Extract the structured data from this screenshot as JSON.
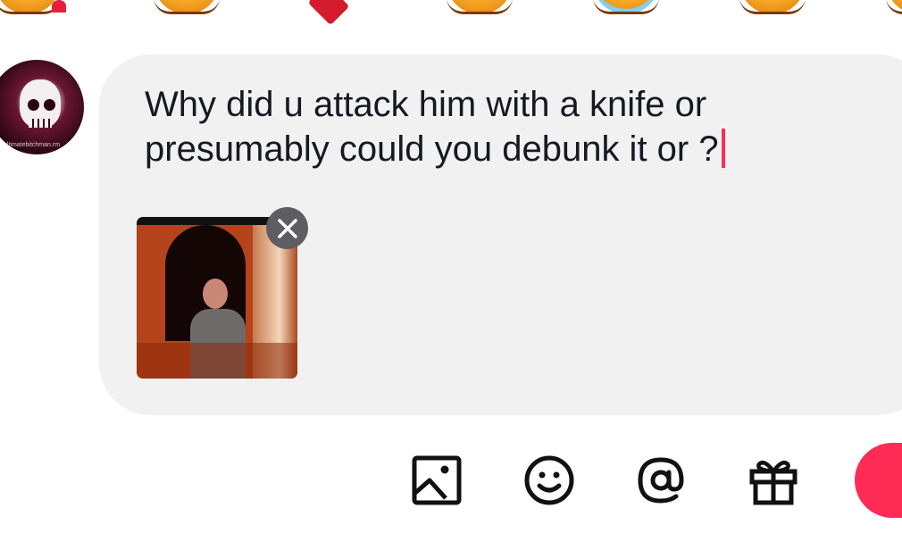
{
  "emoji_strip": {
    "items": [
      {
        "icon": "heart-eyes-face-icon"
      },
      {
        "icon": "face-icon"
      },
      {
        "icon": "heart-icon"
      },
      {
        "icon": "face-icon"
      },
      {
        "icon": "tears-of-joy-face-icon"
      },
      {
        "icon": "face-icon"
      },
      {
        "icon": "face-icon"
      }
    ]
  },
  "avatar": {
    "caption": "ultimatebitchman.rm"
  },
  "compose": {
    "text": "Why did u attack him with a knife or presumably could you debunk it or ?",
    "attachment": {
      "type": "video-thumbnail",
      "remove_icon": "close-icon"
    }
  },
  "toolbar": {
    "buttons": [
      {
        "icon": "image-icon"
      },
      {
        "icon": "emoji-icon"
      },
      {
        "icon": "at-mention-icon"
      },
      {
        "icon": "gift-icon"
      },
      {
        "icon": "send-icon"
      }
    ]
  },
  "colors": {
    "accent": "#fe2c55",
    "bubble": "#f1f1f2",
    "text": "#161823"
  }
}
